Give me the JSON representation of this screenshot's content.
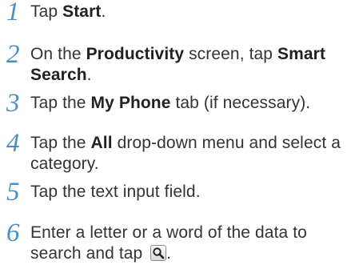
{
  "steps": [
    {
      "num": "1",
      "parts": [
        {
          "t": "Tap ",
          "b": false
        },
        {
          "t": "Start",
          "b": true
        },
        {
          "t": ".",
          "b": false
        }
      ]
    },
    {
      "num": "2",
      "parts": [
        {
          "t": "On the ",
          "b": false
        },
        {
          "t": "Productivity",
          "b": true
        },
        {
          "t": " screen, tap ",
          "b": false
        },
        {
          "t": "Smart Search",
          "b": true
        },
        {
          "t": ".",
          "b": false
        }
      ]
    },
    {
      "num": "3",
      "parts": [
        {
          "t": "Tap the ",
          "b": false
        },
        {
          "t": "My Phone",
          "b": true
        },
        {
          "t": " tab (if necessary).",
          "b": false
        }
      ]
    },
    {
      "num": "4",
      "parts": [
        {
          "t": "Tap the ",
          "b": false
        },
        {
          "t": "All",
          "b": true
        },
        {
          "t": " drop-down menu and select a category.",
          "b": false
        }
      ]
    },
    {
      "num": "5",
      "parts": [
        {
          "t": "Tap the text input field.",
          "b": false
        }
      ]
    },
    {
      "num": "6",
      "parts": [
        {
          "t": "Enter a letter or a word of the data to search and tap ",
          "b": false
        },
        {
          "icon": "search-icon"
        },
        {
          "t": ".",
          "b": false
        }
      ]
    }
  ]
}
